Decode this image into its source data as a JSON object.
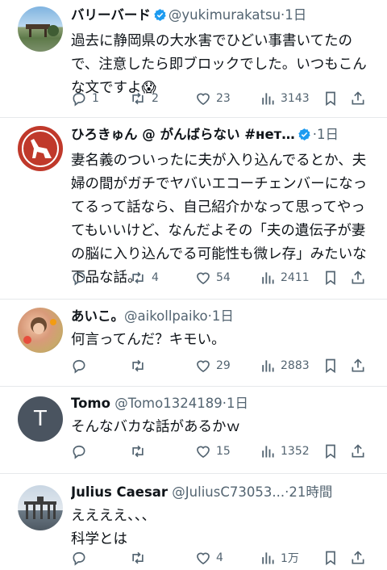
{
  "tweets": [
    {
      "name": "バリーバード",
      "verified": true,
      "handle": "@yukimurakatsu",
      "dot": "·",
      "time": "1日",
      "text": "過去に静岡県の大水害でひどい事書いてたので、注意したら即ブロックでした。いつもこんな文ですよ😱",
      "replies": "1",
      "retweets": "2",
      "likes": "23",
      "views": "3143"
    },
    {
      "name": "ひろきゅん @ がんばらない #нет…",
      "verified": true,
      "handle": "",
      "dot": "·",
      "time": "1日",
      "text": "妻名義のついったに夫が入り込んでるとか、夫婦の間がガチでヤバいエコーチェンバーになってるって話なら、自己紹介かなって思ってやってもいいけど、なんだよその「夫の遺伝子が妻の脳に入り込んでる可能性も微レ存」みたいな下品な話。",
      "replies": "",
      "retweets": "4",
      "likes": "54",
      "views": "2411"
    },
    {
      "name": "あいこ。",
      "verified": false,
      "handle": "@aikollpaiko",
      "dot": "·",
      "time": "1日",
      "text": "何言ってんだ？キモい。",
      "replies": "",
      "retweets": "",
      "likes": "29",
      "views": "2883"
    },
    {
      "name": "Tomo",
      "verified": false,
      "handle": "@Tomo1324189",
      "dot": "·",
      "time": "1日",
      "text": "そんなバカな話があるかｗ",
      "replies": "",
      "retweets": "",
      "likes": "15",
      "views": "1352",
      "avatar_letter": "T"
    },
    {
      "name": "Julius Caesar",
      "verified": false,
      "handle": "@JuliusC73053...",
      "dot": "·",
      "time": "21時間",
      "text": "ええええ、、、\n科学とは",
      "replies": "",
      "retweets": "",
      "likes": "4",
      "views": "1万"
    }
  ],
  "colors": {
    "verified": "#1d9bf0",
    "text": "#0f1419",
    "secondary": "#536471",
    "divider": "#e6e9eb",
    "avatar_hiro": "#c0392b",
    "avatar_tomo": "#4a5460"
  }
}
